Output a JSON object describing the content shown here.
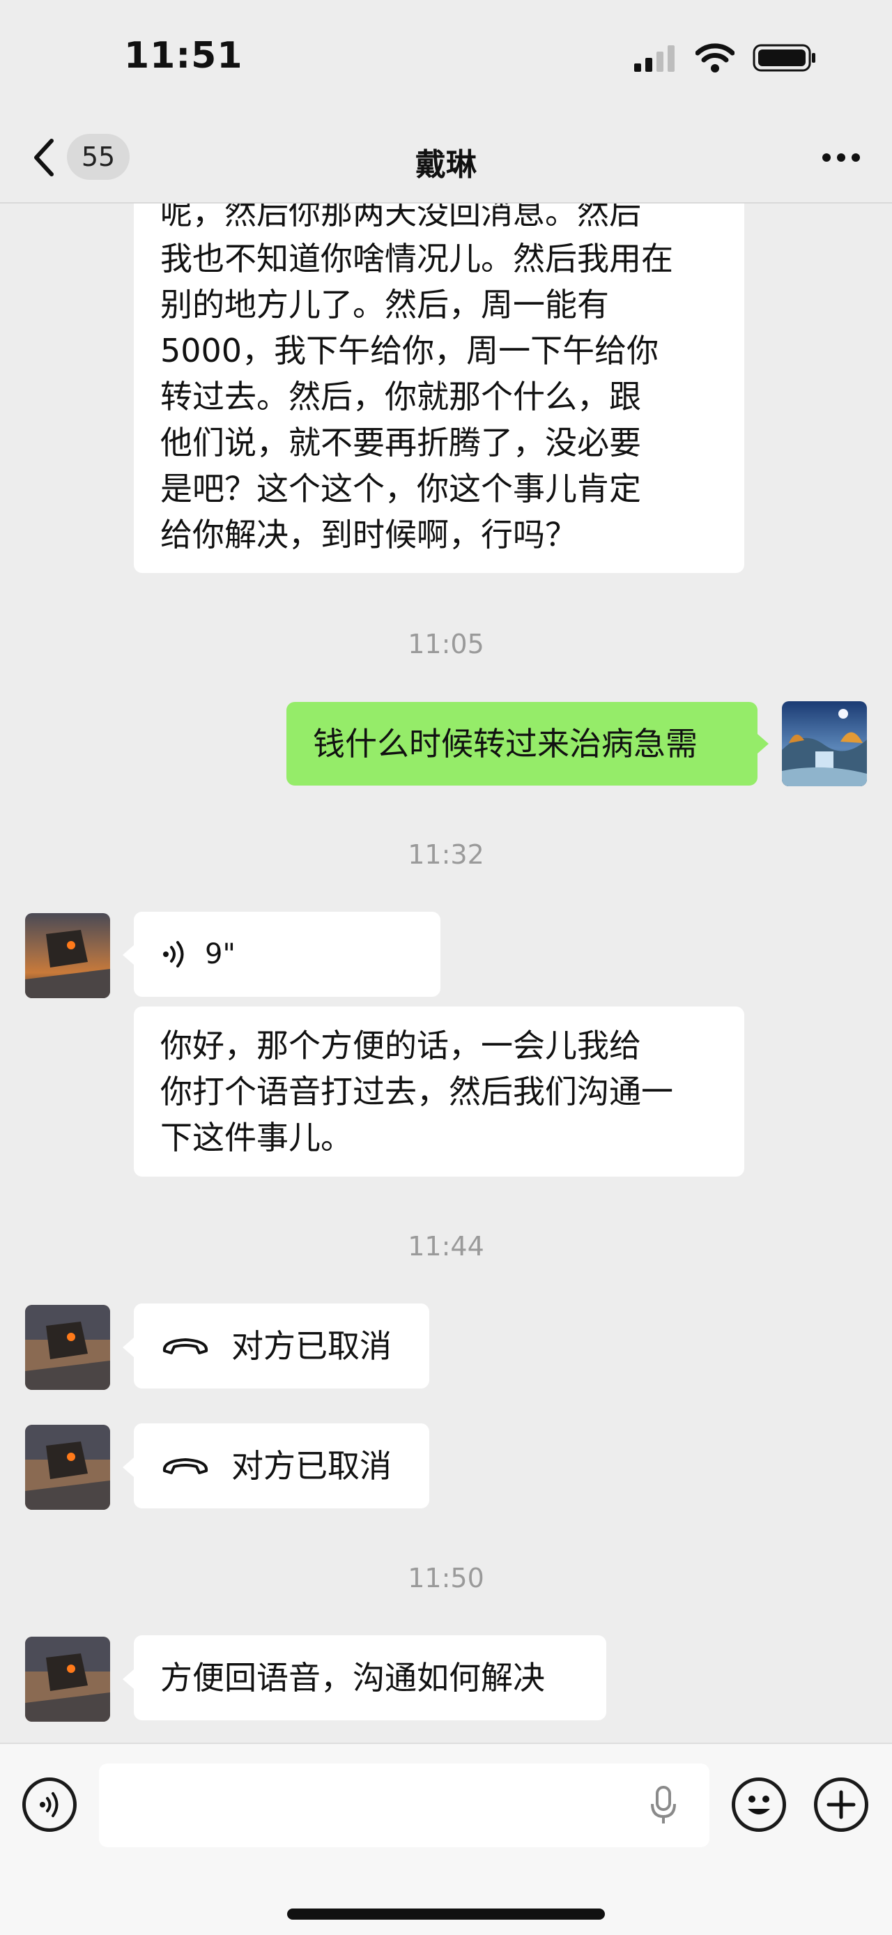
{
  "status_bar": {
    "time": "11:51"
  },
  "nav": {
    "unread_count": "55",
    "title": "戴琳"
  },
  "messages": {
    "m1_lines": [
      "呢，然后你那两天没回消息。然后",
      "我也不知道你啥情况儿。然后我用在",
      "别的地方儿了。然后，周一能有",
      "5000，我下午给你，周一下午给你",
      "转过去。然后，你就那个什么，跟",
      "他们说，就不要再折腾了，没必要",
      "是吧？这个这个，你这个事儿肯定",
      "给你解决，到时候啊，行吗？"
    ],
    "t1": "11:05",
    "m2": "钱什么时候转过来治病急需",
    "t2": "11:32",
    "voice_duration": "9\"",
    "m4_lines": [
      "你好，那个方便的话，一会儿我给",
      "你打个语音打过去，然后我们沟通一",
      "下这件事儿。"
    ],
    "t3": "11:44",
    "call1": "对方已取消",
    "call2": "对方已取消",
    "t4": "11:50",
    "m7": "方便回语音，沟通如何解决"
  },
  "input": {
    "placeholder": ""
  },
  "colors": {
    "background": "#ededed",
    "my_bubble": "#95ec69",
    "their_bubble": "#ffffff",
    "timestamp": "#9a9a9a"
  },
  "icons": [
    "back-icon",
    "more-icon",
    "signal-icon",
    "wifi-icon",
    "battery-icon",
    "voice-wave-icon",
    "hangup-phone-icon",
    "voice-input-icon",
    "microphone-icon",
    "emoji-icon",
    "add-icon"
  ]
}
